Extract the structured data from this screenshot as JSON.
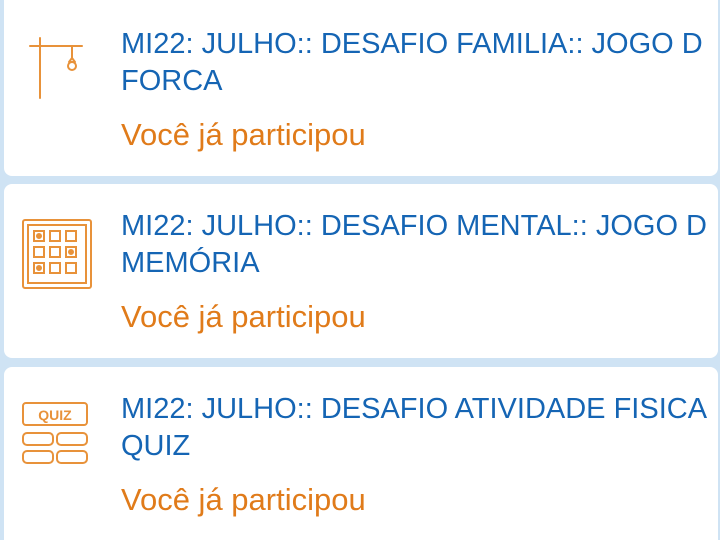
{
  "items": [
    {
      "icon": "hangman-icon",
      "title_line1": "MI22: JULHO:: DESAFIO FAMILIA:: JOGO D",
      "title_line2": "FORCA",
      "status": "Você já participou"
    },
    {
      "icon": "memory-grid-icon",
      "title_line1": "MI22: JULHO:: DESAFIO MENTAL:: JOGO D",
      "title_line2": "MEMÓRIA",
      "status": "Você já participou"
    },
    {
      "icon": "quiz-icon",
      "icon_text": "QUIZ",
      "title_line1": "MI22: JULHO:: DESAFIO ATIVIDADE FISICA",
      "title_line2": "QUIZ",
      "status": "Você já participou"
    }
  ],
  "colors": {
    "background": "#cfe3f4",
    "card": "#ffffff",
    "title": "#1565b4",
    "status": "#e07b1a",
    "icon": "#e8923a"
  }
}
